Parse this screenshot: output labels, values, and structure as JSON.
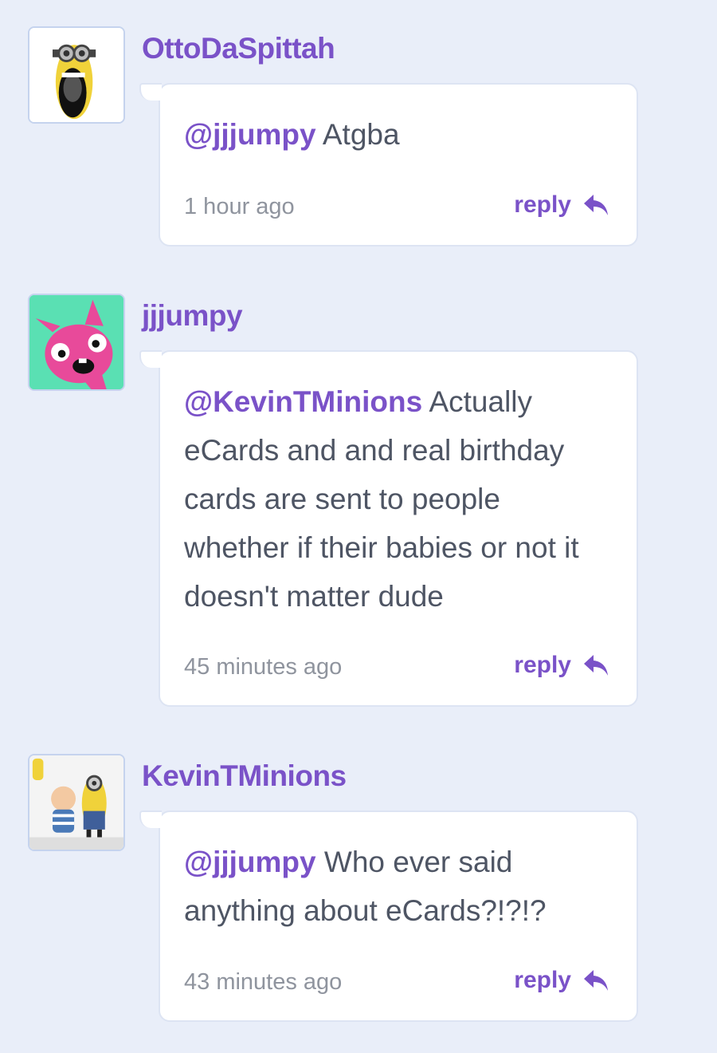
{
  "comments": [
    {
      "username": "OttoDaSpittah",
      "avatar_icon": "minion-laughing-avatar",
      "mention": "@jjjumpy",
      "text": "Atgba",
      "timestamp": "1 hour ago",
      "reply_label": "reply"
    },
    {
      "username": "jjjumpy",
      "avatar_icon": "pink-cartoon-dog-avatar",
      "mention": "@KevinTMinions",
      "text": "Actually eCards and and real birthday cards are sent to people whether if their babies or not it doesn't matter dude",
      "timestamp": "45 minutes ago",
      "reply_label": "reply"
    },
    {
      "username": "KevinTMinions",
      "avatar_icon": "minion-and-baby-avatar",
      "mention": "@jjjumpy",
      "text": "Who ever said anything about eCards?!?!?",
      "timestamp": "43 minutes ago",
      "reply_label": "reply"
    }
  ],
  "colors": {
    "background": "#e9eef9",
    "accent": "#7a52c8",
    "text": "#4e5564",
    "muted": "#8f949e"
  }
}
